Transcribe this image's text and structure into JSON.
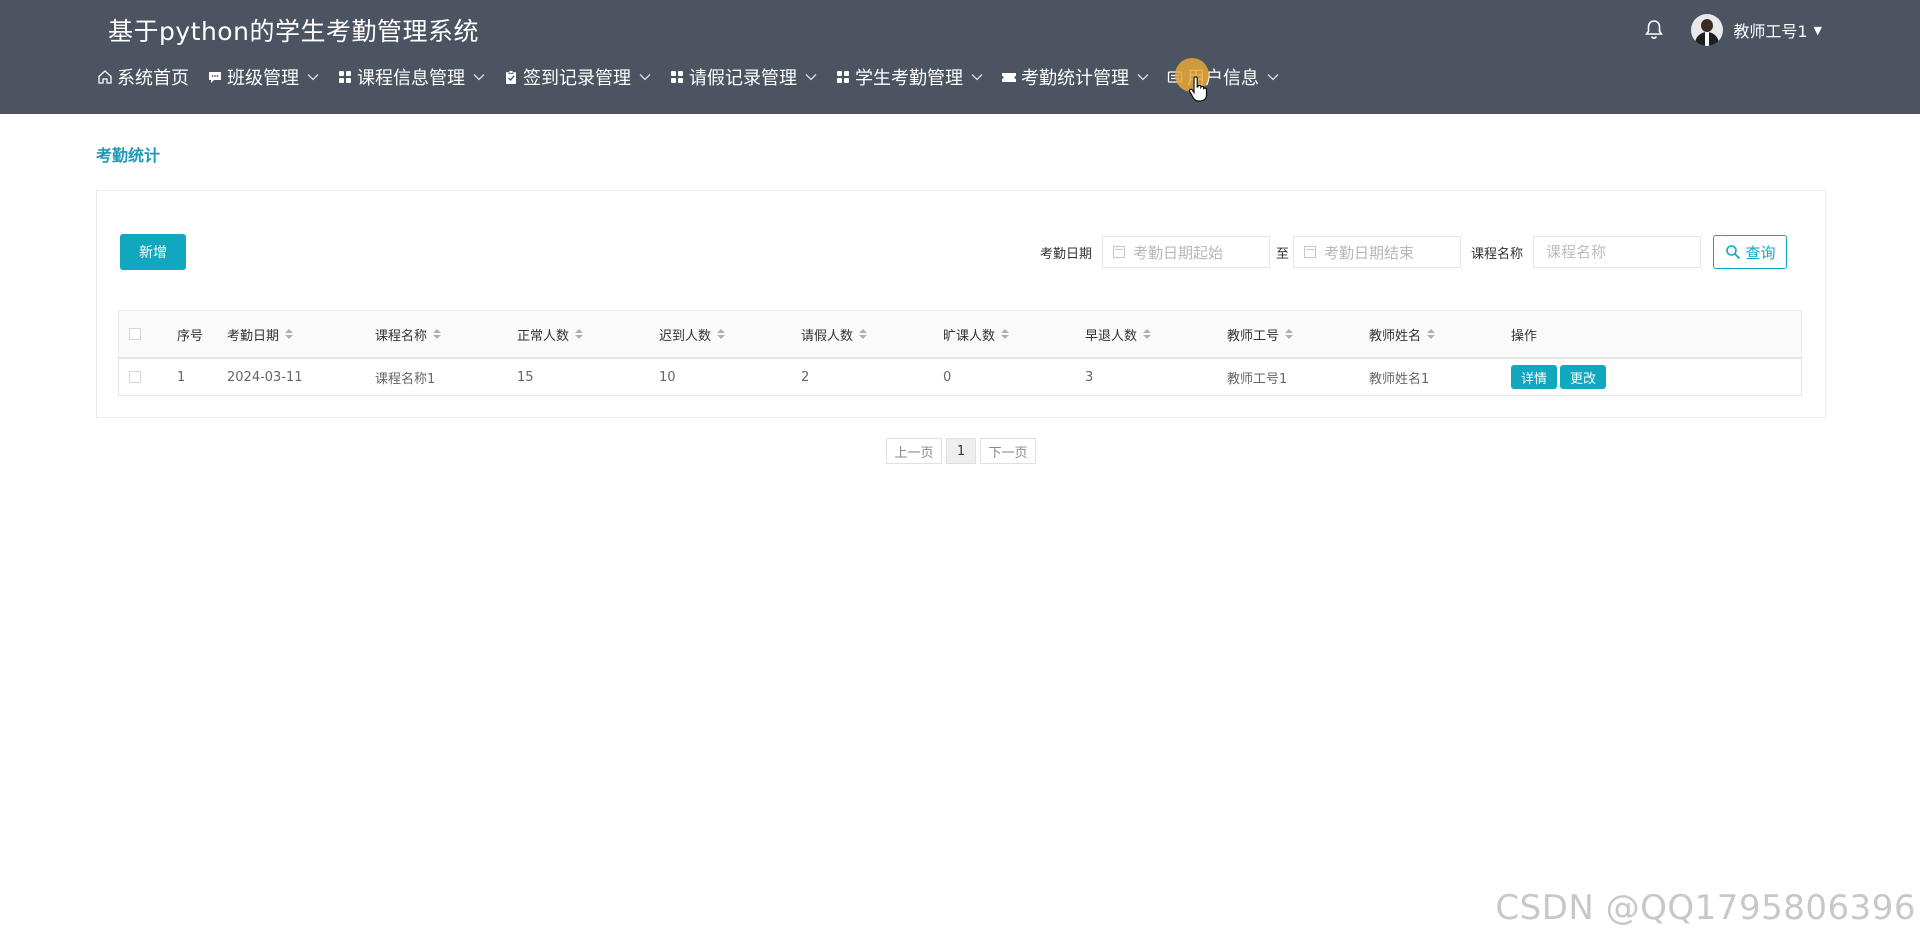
{
  "app": {
    "title": "基于python的学生考勤管理系统"
  },
  "user": {
    "name": "教师工号1"
  },
  "nav": [
    {
      "label": "系统首页",
      "icon": "home-icon",
      "dropdown": false
    },
    {
      "label": "班级管理",
      "icon": "chat-icon",
      "dropdown": true
    },
    {
      "label": "课程信息管理",
      "icon": "grid-icon",
      "dropdown": true
    },
    {
      "label": "签到记录管理",
      "icon": "clipboard-icon",
      "dropdown": true
    },
    {
      "label": "请假记录管理",
      "icon": "grid-icon",
      "dropdown": true
    },
    {
      "label": "学生考勤管理",
      "icon": "grid-icon",
      "dropdown": true
    },
    {
      "label": "考勤统计管理",
      "icon": "ticket-icon",
      "dropdown": true
    },
    {
      "label": "用户信息",
      "icon": "id-card-icon",
      "dropdown": true
    }
  ],
  "page": {
    "title": "考勤统计"
  },
  "toolbar": {
    "add_label": "新增"
  },
  "search": {
    "date_label": "考勤日期",
    "date_start_placeholder": "考勤日期起始",
    "to_label": "至",
    "date_end_placeholder": "考勤日期结束",
    "course_label": "课程名称",
    "course_placeholder": "课程名称",
    "query_label": "查询"
  },
  "table": {
    "headers": [
      "序号",
      "考勤日期",
      "课程名称",
      "正常人数",
      "迟到人数",
      "请假人数",
      "旷课人数",
      "早退人数",
      "教师工号",
      "教师姓名",
      "操作"
    ],
    "rows": [
      {
        "index": "1",
        "date": "2024-03-11",
        "course": "课程名称1",
        "normal": "15",
        "late": "10",
        "leave": "2",
        "absent": "0",
        "early": "3",
        "teacher_id": "教师工号1",
        "teacher_name": "教师姓名1"
      }
    ],
    "actions": {
      "detail": "详情",
      "edit": "更改"
    }
  },
  "pagination": {
    "prev": "上一页",
    "current": "1",
    "next": "下一页"
  },
  "watermark": "CSDN @QQ1795806396",
  "colors": {
    "header_bg": "#4c5462",
    "accent": "#10a7bf",
    "title": "#1c9ab3"
  }
}
